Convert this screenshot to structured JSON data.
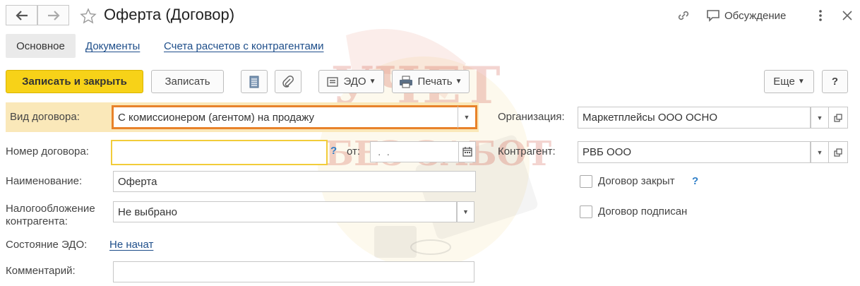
{
  "window": {
    "title": "Оферта (Договор)",
    "discussion_label": "Обсуждение"
  },
  "tabs": [
    {
      "label": "Основное",
      "active": true
    },
    {
      "label": "Документы",
      "active": false
    },
    {
      "label": "Счета расчетов с контрагентами",
      "active": false
    }
  ],
  "toolbar": {
    "save_close": "Записать и закрыть",
    "save": "Записать",
    "edo": "ЭДО",
    "print": "Печать",
    "more": "Еще",
    "help": "?"
  },
  "form": {
    "contract_type": {
      "label": "Вид договора:",
      "value": "С комиссионером (агентом) на продажу"
    },
    "contract_number": {
      "label": "Номер договора:",
      "value": "",
      "from_label": "от:",
      "date_value": " .  . "
    },
    "name": {
      "label": "Наименование:",
      "value": "Оферта"
    },
    "taxation": {
      "label_line1": "Налогообложение",
      "label_line2": "контрагента:",
      "value": "Не выбрано"
    },
    "edo_state": {
      "label": "Состояние ЭДО:",
      "value": "Не начат"
    },
    "comment": {
      "label": "Комментарий:",
      "value": ""
    },
    "organization": {
      "label": "Организация:",
      "value": "Маркетплейсы ООО ОСНО"
    },
    "counterparty": {
      "label": "Контрагент:",
      "value": "РВБ ООО"
    },
    "contract_closed": {
      "label": "Договор закрыт",
      "checked": false
    },
    "contract_signed": {
      "label": "Договор подписан",
      "checked": false
    },
    "help_mark": "?"
  },
  "watermark": {
    "line1": "УЧЕТ",
    "line2": "БЕЗ ЗАБОТ"
  },
  "colors": {
    "primary_button": "#f7d218",
    "highlight_row": "#fae8b9",
    "focus_orange": "#e8822a",
    "focus_yellow": "#f2cc3a",
    "link": "#1e4e8a",
    "help_blue": "#2f7fc8"
  },
  "icons": {
    "back": "arrow-left-icon",
    "forward": "arrow-right-icon",
    "favorite": "star-icon",
    "link": "link-icon",
    "discussion": "chat-icon",
    "menu": "more-vertical-icon",
    "close": "close-icon",
    "report": "document-list-icon",
    "attach": "paperclip-icon",
    "edo": "edo-icon",
    "print": "printer-icon",
    "calendar": "calendar-icon",
    "open": "open-form-icon"
  }
}
